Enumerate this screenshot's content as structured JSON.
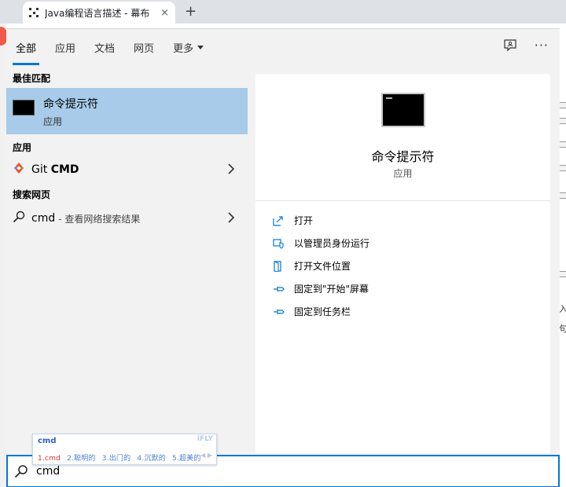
{
  "browser": {
    "tab_title": "Java编程语言描述 - 幕布",
    "tab_close": "×",
    "new_tab": "+"
  },
  "background": {
    "right_edge_texts": [
      "入",
      "句"
    ]
  },
  "search_menu": {
    "tabs": [
      {
        "label": "全部",
        "active": true
      },
      {
        "label": "应用",
        "active": false
      },
      {
        "label": "文档",
        "active": false
      },
      {
        "label": "网页",
        "active": false
      },
      {
        "label": "更多",
        "active": false
      }
    ],
    "more_icon": "···",
    "best_match": {
      "heading": "最佳匹配",
      "name": "命令提示符",
      "subtitle": "应用"
    },
    "apps": {
      "heading": "应用",
      "item_prefix": "Git ",
      "item_bold": "CMD"
    },
    "web": {
      "heading": "搜索网页",
      "query": "cmd",
      "hint": "- 查看网络搜索结果"
    },
    "preview": {
      "name": "命令提示符",
      "subtitle": "应用"
    },
    "actions": [
      {
        "label": "打开",
        "icon": "open-icon"
      },
      {
        "label": "以管理员身份运行",
        "icon": "shield-admin-icon"
      },
      {
        "label": "打开文件位置",
        "icon": "folder-location-icon"
      },
      {
        "label": "固定到\"开始\"屏幕",
        "icon": "pin-icon"
      },
      {
        "label": "固定到任务栏",
        "icon": "pin-icon"
      }
    ],
    "search_value": "cmd"
  },
  "ime": {
    "composition": "cmd",
    "brand": "iFLY",
    "candidates": [
      "1.cmd",
      "2.聪明的",
      "3.出门的",
      "4.沉默的",
      "5.超美的"
    ],
    "pager": "◀ ▶"
  },
  "colors": {
    "accent": "#0078d7",
    "selected_row": "#a7cbe8",
    "panel_bg": "#f2f2f2"
  }
}
